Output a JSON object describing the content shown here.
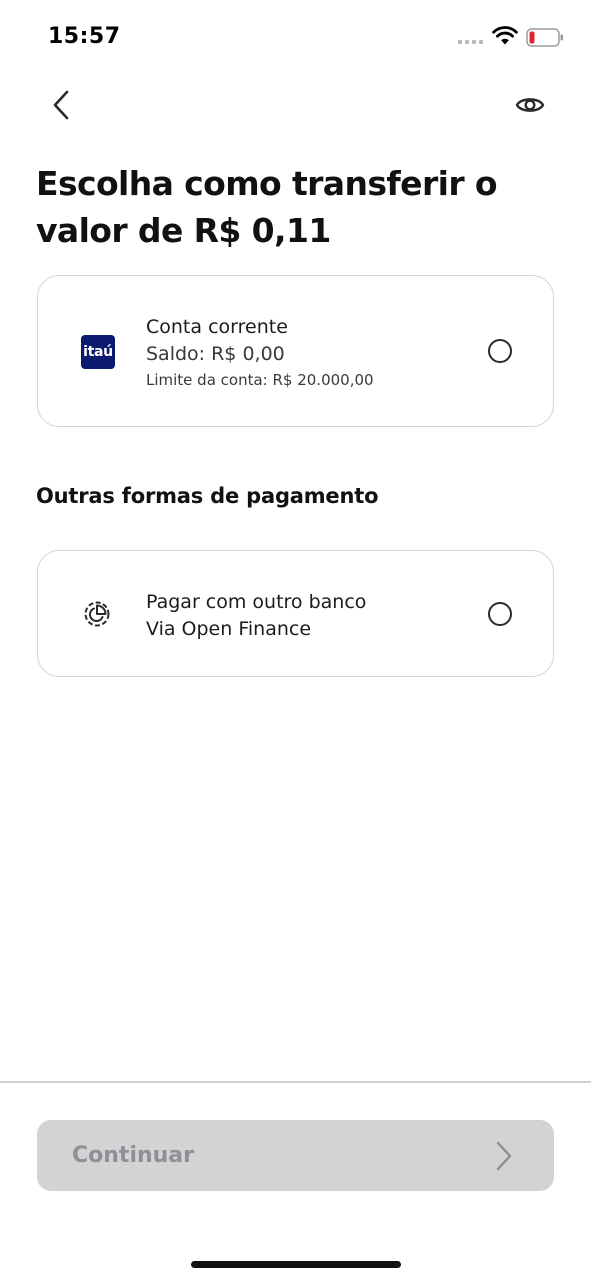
{
  "status_bar": {
    "time": "15:57",
    "battery_color": "#e0262a"
  },
  "nav": {
    "back_icon": "chevron-left-icon",
    "visibility_icon": "eye-icon"
  },
  "page": {
    "title": "Escolha como transferir o valor de R$ 0,11"
  },
  "account_option": {
    "bank_logo_text": "itaú",
    "title": "Conta corrente",
    "balance": "Saldo: R$ 0,00",
    "limit": "Limite da conta: R$ 20.000,00",
    "selected": false
  },
  "other_payments": {
    "section_title": "Outras formas de pagamento",
    "option": {
      "title": "Pagar com outro banco",
      "subtitle": "Via Open Finance",
      "icon": "open-finance-icon",
      "selected": false
    }
  },
  "footer": {
    "continue_label": "Continuar",
    "continue_enabled": false
  },
  "colors": {
    "itau_blue": "#0c1a6e",
    "disabled_button": "#d2d3d5",
    "disabled_text": "#8e9094"
  }
}
